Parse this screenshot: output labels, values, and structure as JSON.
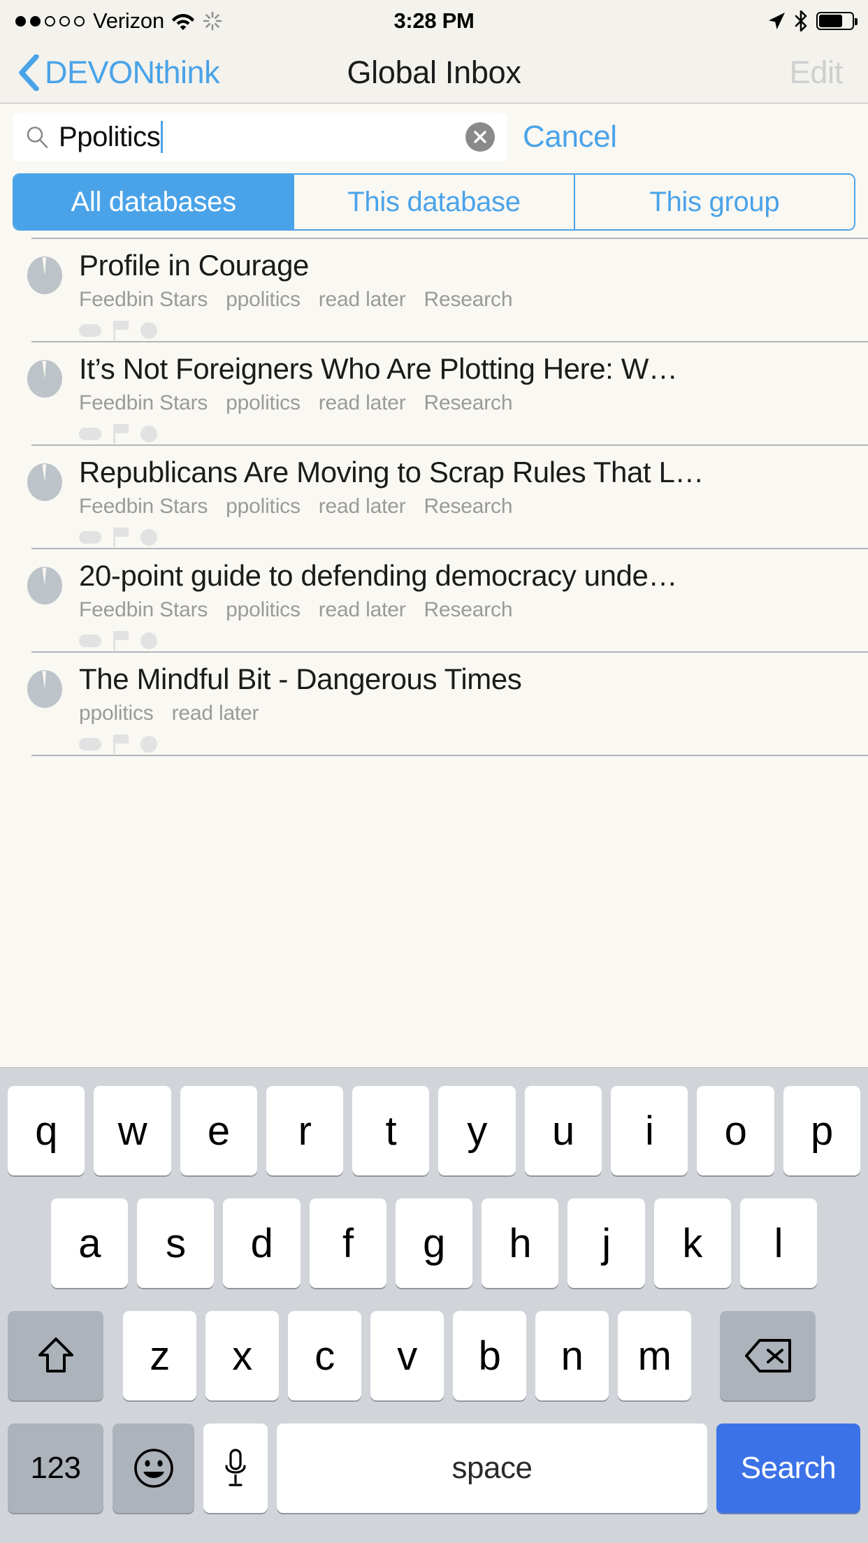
{
  "status_bar": {
    "signal_dots_filled": 2,
    "signal_dots_total": 5,
    "carrier": "Verizon",
    "time": "3:28 PM",
    "wifi_icon": "wifi-icon",
    "activity_icon": "activity-spinner-icon",
    "location_icon": "location-arrow-icon",
    "bluetooth_icon": "bluetooth-icon",
    "battery_icon": "battery-icon",
    "battery_level_percent": 65
  },
  "nav_bar": {
    "back_label": "DEVONthink",
    "back_icon": "chevron-left-icon",
    "title": "Global Inbox",
    "edit_label": "Edit",
    "edit_enabled": false
  },
  "search": {
    "value": "Ppolitics",
    "placeholder": "Search",
    "search_icon": "search-icon",
    "clear_icon": "clear-circle-icon",
    "cancel_label": "Cancel"
  },
  "scope": {
    "selected_index": 0,
    "options": [
      {
        "label": "All databases"
      },
      {
        "label": "This database"
      },
      {
        "label": "This group"
      }
    ]
  },
  "results": [
    {
      "title": "Profile in Courage",
      "tags": [
        "Feedbin Stars",
        "ppolitics",
        "read later",
        "Research"
      ],
      "icon": "document-score-circle-icon",
      "badges": [
        "label-badge-icon",
        "flag-badge-icon",
        "dot-badge-icon"
      ]
    },
    {
      "title": "It’s Not Foreigners Who Are Plotting Here: W…",
      "tags": [
        "Feedbin Stars",
        "ppolitics",
        "read later",
        "Research"
      ],
      "icon": "document-score-circle-icon",
      "badges": [
        "label-badge-icon",
        "flag-badge-icon",
        "dot-badge-icon"
      ]
    },
    {
      "title": "Republicans Are Moving to Scrap Rules That L…",
      "tags": [
        "Feedbin Stars",
        "ppolitics",
        "read later",
        "Research"
      ],
      "icon": "document-score-circle-icon",
      "badges": [
        "label-badge-icon",
        "flag-badge-icon",
        "dot-badge-icon"
      ]
    },
    {
      "title": "20-point guide to defending democracy unde…",
      "tags": [
        "Feedbin Stars",
        "ppolitics",
        "read later",
        "Research"
      ],
      "icon": "document-score-circle-icon",
      "badges": [
        "label-badge-icon",
        "flag-badge-icon",
        "dot-badge-icon"
      ]
    },
    {
      "title": "The Mindful Bit - Dangerous Times",
      "tags": [
        "ppolitics",
        "read later"
      ],
      "icon": "document-score-circle-icon",
      "badges": [
        "label-badge-icon",
        "flag-badge-icon",
        "dot-badge-icon"
      ]
    }
  ],
  "keyboard": {
    "row1": [
      "q",
      "w",
      "e",
      "r",
      "t",
      "y",
      "u",
      "i",
      "o",
      "p"
    ],
    "row2": [
      "a",
      "s",
      "d",
      "f",
      "g",
      "h",
      "j",
      "k",
      "l"
    ],
    "row3": [
      "z",
      "x",
      "c",
      "v",
      "b",
      "n",
      "m"
    ],
    "shift_icon": "shift-up-arrow-icon",
    "backspace_icon": "backspace-delete-icon",
    "numbers_label": "123",
    "emoji_icon": "smiley-face-icon",
    "dictation_icon": "microphone-icon",
    "space_label": "space",
    "return_label": "Search"
  },
  "colors": {
    "accent_blue": "#4aa3e8",
    "return_key_blue": "#3c72e8",
    "background": "#faf8f3",
    "nav_background": "#f4f2ed",
    "keyboard_background": "#d1d5da",
    "key_dark": "#adb3ba",
    "tag_gray": "#9a9a9a",
    "separator_gray": "#b0b6ba",
    "disabled_gray": "#cfcfcf"
  }
}
